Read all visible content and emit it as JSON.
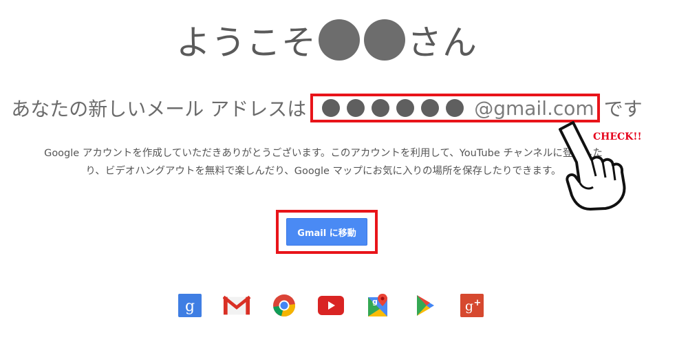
{
  "welcome": {
    "prefix": "ようこそ",
    "suffix": "さん"
  },
  "address": {
    "prefix": "あなたの新しいメール アドレスは",
    "domain": "@gmail.com",
    "suffix": "です",
    "highlight_color": "#e8141a"
  },
  "description": {
    "line1": "Google アカウントを作成していただきありがとうございます。このアカウントを利用して、YouTube チャンネルに登録した",
    "line2": "り、ビデオハングアウトを無料で楽しんだり、Google マップにお気に入りの場所を保存したりできます。"
  },
  "annotation": {
    "check_label": "CHECK!!",
    "color": "#e5001b"
  },
  "button": {
    "label": "Gmail に移動",
    "color": "#4a8af4"
  },
  "services": [
    "google-search-icon",
    "gmail-icon",
    "chrome-icon",
    "youtube-icon",
    "maps-icon",
    "play-store-icon",
    "google-plus-icon"
  ]
}
